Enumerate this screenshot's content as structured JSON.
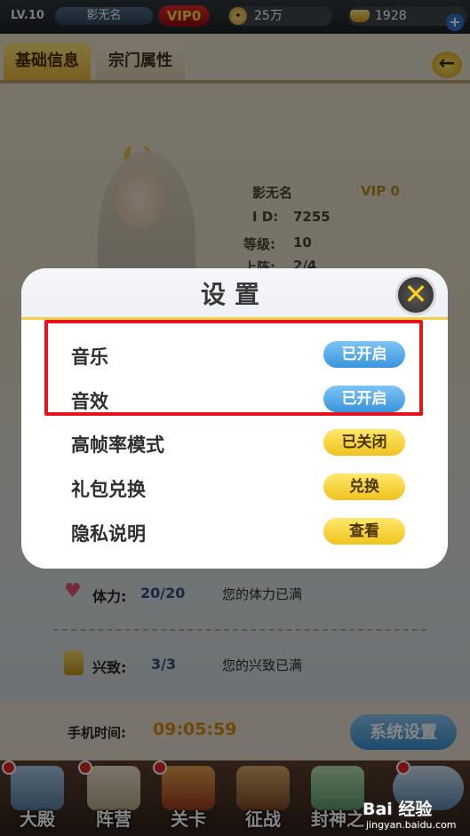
{
  "topbar": {
    "level": "LV.10",
    "player_name": "影无名",
    "vip": "VIP0",
    "gold": "25万",
    "ingots": "1928"
  },
  "tabs": [
    "基础信息",
    "宗门属性"
  ],
  "profile": {
    "name": "影无名",
    "vip": "VIP 0",
    "id_label": "I D:",
    "id_value": "7255",
    "level_label": "等级:",
    "level_value": "10",
    "lineup_label": "上阵:",
    "lineup_value": "2/4"
  },
  "stats": [
    {
      "label": "体力:",
      "value": "20/20",
      "note": "您的体力已满"
    },
    {
      "label": "兴致:",
      "value": "3/3",
      "note": "您的兴致已满"
    }
  ],
  "phone_time": {
    "label": "手机时间:",
    "value": "09:05:59"
  },
  "system_settings_button": "系统设置",
  "bottom_nav": [
    "大殿",
    "阵营",
    "关卡",
    "征战",
    "封神之"
  ],
  "dialog": {
    "title": "设置",
    "rows": [
      {
        "label": "音乐",
        "button": "已开启",
        "style": "blue"
      },
      {
        "label": "音效",
        "button": "已开启",
        "style": "blue"
      },
      {
        "label": "高帧率模式",
        "button": "已关闭",
        "style": "yellow"
      },
      {
        "label": "礼包兑换",
        "button": "兑换",
        "style": "yellow"
      },
      {
        "label": "隐私说明",
        "button": "查看",
        "style": "yellow"
      }
    ]
  },
  "watermark": {
    "logo": "Bai 经验",
    "url": "jingyan.baidu.com"
  },
  "colors": {
    "highlight": "#e4141a",
    "blue_pill": "#3a94dc",
    "yellow_pill": "#f0c21e",
    "close_x": "#ffd21a"
  }
}
